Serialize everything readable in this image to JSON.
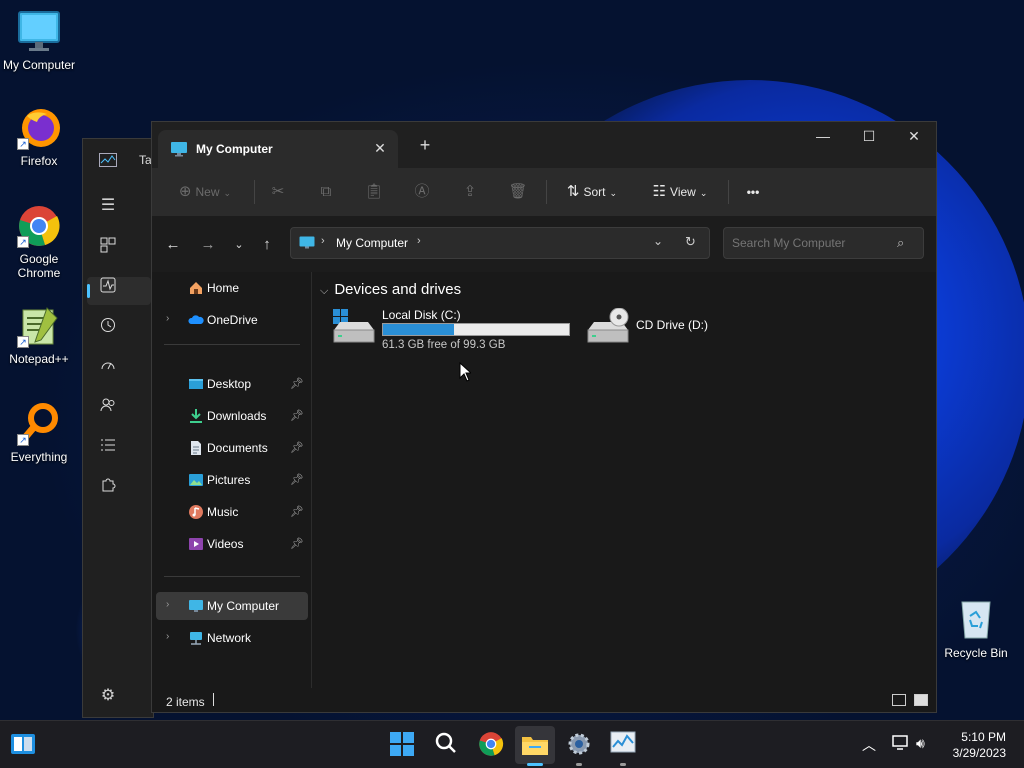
{
  "desktop": {
    "icons": [
      {
        "label": "My Computer"
      },
      {
        "label": "Firefox"
      },
      {
        "label": "Google Chrome"
      },
      {
        "label": "Notepad++"
      },
      {
        "label": "Everything"
      }
    ],
    "recycle_bin": "Recycle Bin"
  },
  "background_window": {
    "title_fragment": "Ta"
  },
  "explorer": {
    "tab_title": "My Computer",
    "toolbar": {
      "new_label": "New",
      "sort_label": "Sort",
      "view_label": "View",
      "more_label": "•••"
    },
    "address": {
      "crumb": "My Computer"
    },
    "search": {
      "placeholder": "Search My Computer"
    },
    "sidebar": {
      "top": [
        {
          "label": "Home"
        },
        {
          "label": "OneDrive"
        }
      ],
      "quick": [
        {
          "label": "Desktop"
        },
        {
          "label": "Downloads"
        },
        {
          "label": "Documents"
        },
        {
          "label": "Pictures"
        },
        {
          "label": "Music"
        },
        {
          "label": "Videos"
        }
      ],
      "bottom": [
        {
          "label": "My Computer"
        },
        {
          "label": "Network"
        }
      ]
    },
    "group_header": "Devices and drives",
    "drives": [
      {
        "name": "Local Disk (C:)",
        "free_text": "61.3 GB free of 99.3 GB",
        "used_fraction": 0.383
      },
      {
        "name": "CD Drive (D:)"
      }
    ],
    "status": {
      "items": "2 items"
    }
  },
  "taskbar": {
    "clock_time": "5:10 PM",
    "clock_date": "3/29/2023"
  },
  "colors": {
    "accent": "#4cc2ff",
    "drive_bar": "#2a8fd6",
    "window_bg": "#191919",
    "toolbar_bg": "#2b2b2b"
  }
}
